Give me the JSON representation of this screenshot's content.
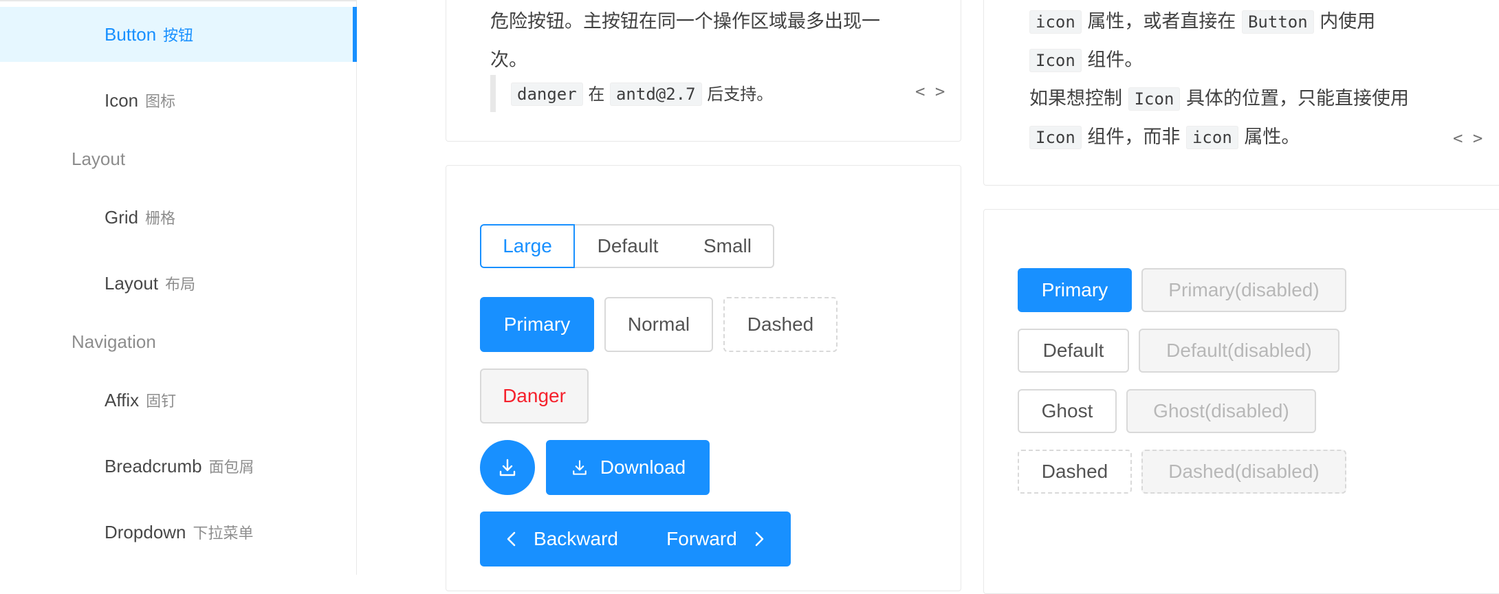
{
  "sidebar": {
    "items": [
      {
        "en": "Button",
        "zh": "按钮"
      },
      {
        "en": "Icon",
        "zh": "图标"
      },
      {
        "en": "Grid",
        "zh": "栅格"
      },
      {
        "en": "Layout",
        "zh": "布局"
      },
      {
        "en": "Affix",
        "zh": "固钉"
      },
      {
        "en": "Breadcrumb",
        "zh": "面包屑"
      },
      {
        "en": "Dropdown",
        "zh": "下拉菜单"
      }
    ],
    "groups": {
      "layout": "Layout",
      "navigation": "Navigation"
    }
  },
  "left_card": {
    "line1": "危险按钮。主按钮在同一个操作区域最多出现一",
    "line2": "次。",
    "note_code1": "danger",
    "note_mid": "在",
    "note_code2": "antd@2.7",
    "note_tail": "后支持。",
    "toggle": "< >"
  },
  "right_card": {
    "r1_code": "icon",
    "r1_mid": "属性，或者直接在",
    "r1_code2": "Button",
    "r1_tail": "内使用",
    "r2_code": "Icon",
    "r2_tail": "组件。",
    "r3_head": "如果想控制",
    "r3_code": "Icon",
    "r3_tail": "具体的位置，只能直接使用",
    "r4_code": "Icon",
    "r4_mid": "组件，而非",
    "r4_code2": "icon",
    "r4_tail": "属性。",
    "toggle": "< >"
  },
  "size_demo": {
    "sizes": [
      "Large",
      "Default",
      "Small"
    ],
    "selected": "Large",
    "primary": "Primary",
    "normal": "Normal",
    "dashed": "Dashed",
    "danger": "Danger",
    "download": "Download",
    "backward": "Backward",
    "forward": "Forward"
  },
  "disabled_demo": {
    "primary": "Primary",
    "primary_disabled": "Primary(disabled)",
    "default": "Default",
    "default_disabled": "Default(disabled)",
    "ghost": "Ghost",
    "ghost_disabled": "Ghost(disabled)",
    "dashed": "Dashed",
    "dashed_disabled": "Dashed(disabled)"
  },
  "colors": {
    "primary": "#1890ff",
    "danger": "#f5222d",
    "active_bg": "#e6f7ff"
  }
}
